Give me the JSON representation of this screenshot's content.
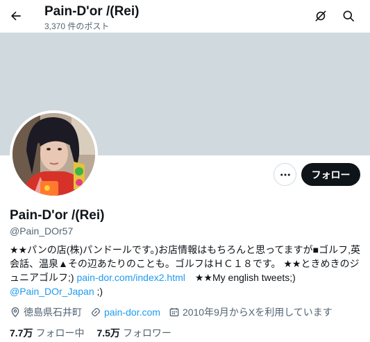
{
  "header": {
    "title": "Pain-D'or /(Rei)",
    "post_count": "3,370 件のポスト"
  },
  "profile": {
    "display_name": "Pain-D'or /(Rei)",
    "handle": "@Pain_DOr57",
    "follow_label": "フォロー",
    "bio": {
      "text1": "★★パンの店(株)パンドールです。)お店情報はもちろんと思ってますが■ゴルフ,英会話、温泉▲その辺あたりのことも。ゴルフはＨＣ１８です。 ★★ときめきのジュニアゴルフ;) ",
      "link1": "pain-dor.com/index2.html",
      "text2": "　★★My english tweets;) ",
      "link2": "@Pain_DOr_Japan",
      "text3": " ;)"
    },
    "location": "徳島県石井町",
    "website": "pain-dor.com",
    "joined": "2010年9月からXを利用しています",
    "following_count": "7.7万",
    "following_label": "フォロー中",
    "followers_count": "7.5万",
    "followers_label": "フォロワー"
  },
  "icons": {
    "back": "back-arrow-icon",
    "premium": "premium-sign-icon",
    "search": "search-icon",
    "more": "more-icon",
    "location": "location-icon",
    "link": "link-icon",
    "calendar": "calendar-icon"
  },
  "colors": {
    "banner": "#cfd9de",
    "link": "#1d9bf0",
    "follow_button": "#0f1419",
    "secondary_text": "#536471"
  }
}
